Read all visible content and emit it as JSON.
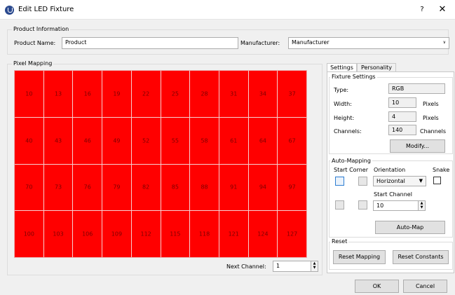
{
  "window": {
    "title": "Edit LED Fixture",
    "help_label": "?",
    "close_label": "✕"
  },
  "product_info": {
    "group_label": "Product Information",
    "product_name_label": "Product Name:",
    "product_name_value": "Product",
    "manufacturer_label": "Manufacturer:",
    "manufacturer_value": "Manufacturer"
  },
  "pixel_mapping": {
    "group_label": "Pixel Mapping",
    "cells": [
      [
        "10",
        "13",
        "16",
        "19",
        "22",
        "25",
        "28",
        "31",
        "34",
        "37"
      ],
      [
        "40",
        "43",
        "46",
        "49",
        "52",
        "55",
        "58",
        "61",
        "64",
        "67"
      ],
      [
        "70",
        "73",
        "76",
        "79",
        "82",
        "85",
        "88",
        "91",
        "94",
        "97"
      ],
      [
        "100",
        "103",
        "106",
        "109",
        "112",
        "115",
        "118",
        "121",
        "124",
        "127"
      ]
    ],
    "next_channel_label": "Next Channel:",
    "next_channel_value": "1"
  },
  "tabs": [
    "Settings",
    "Personality"
  ],
  "fixture_settings": {
    "group_label": "Fixture Settings",
    "type_label": "Type:",
    "type_value": "RGB",
    "width_label": "Width:",
    "width_value": "10",
    "width_unit": "Pixels",
    "height_label": "Height:",
    "height_value": "4",
    "height_unit": "Pixels",
    "channels_label": "Channels:",
    "channels_value": "140",
    "channels_unit": "Channels",
    "modify_label": "Modify..."
  },
  "auto_mapping": {
    "group_label": "Auto-Mapping",
    "start_corner_label": "Start Corner",
    "orientation_label": "Orientation",
    "orientation_value": "Horizontal",
    "snake_label": "Snake",
    "start_channel_label": "Start Channel",
    "start_channel_value": "10",
    "automap_label": "Auto-Map"
  },
  "reset": {
    "group_label": "Reset",
    "reset_mapping_label": "Reset Mapping",
    "reset_constants_label": "Reset Constants"
  },
  "dialog": {
    "ok_label": "OK",
    "cancel_label": "Cancel"
  },
  "colors": {
    "pixel_fill": "#ff0000",
    "selected_corner": "#2d7dd2"
  }
}
